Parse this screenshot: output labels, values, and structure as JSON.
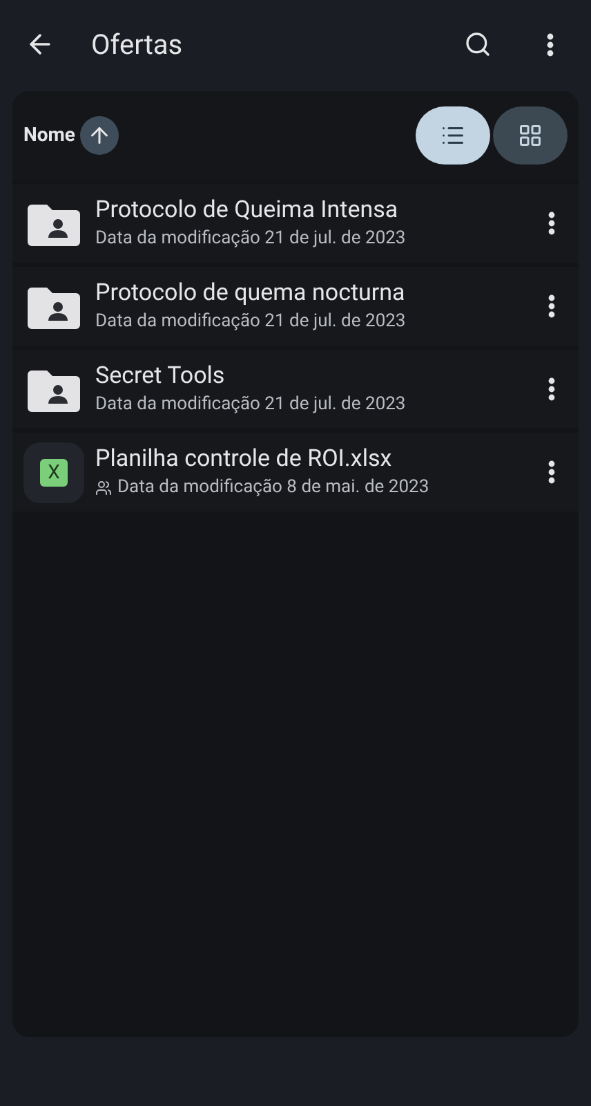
{
  "app_bar": {
    "title": "Ofertas"
  },
  "sort": {
    "label": "Nome"
  },
  "view_toggle": [
    {
      "kind": "list",
      "selected": true
    },
    {
      "kind": "grid",
      "selected": false
    }
  ],
  "files": [
    {
      "kind": "folder",
      "name": "Protocolo de Queima Intensa",
      "meta": "Data da modificação 21 de jul. de 2023",
      "shared": false
    },
    {
      "kind": "folder",
      "name": "Protocolo de quema nocturna",
      "meta": "Data da modificação 21 de jul. de 2023",
      "shared": false
    },
    {
      "kind": "folder",
      "name": "Secret Tools",
      "meta": "Data da modificação 21 de jul. de 2023",
      "shared": false
    },
    {
      "kind": "sheet",
      "icon_letter": "X",
      "name": "Planilha controle de ROI.xlsx",
      "meta": "Data da modificação 8 de mai. de 2023",
      "shared": true
    }
  ]
}
